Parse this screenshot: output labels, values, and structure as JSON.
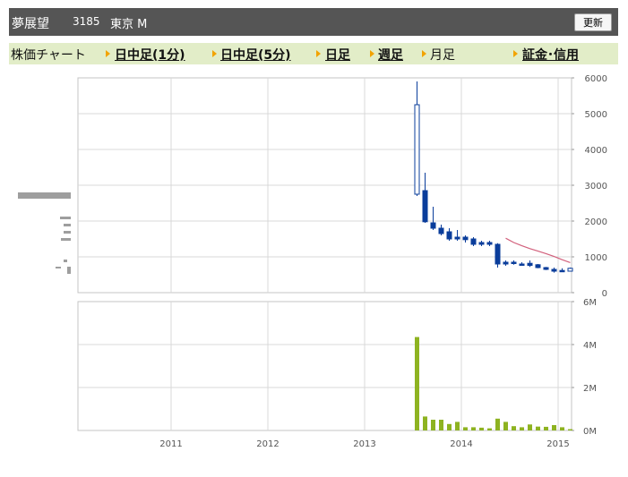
{
  "header": {
    "name": "夢展望",
    "code": "3185",
    "market": "東京 M",
    "refresh_label": "更新"
  },
  "tabs": [
    {
      "label": "株価チャート",
      "link": false
    },
    {
      "label": "日中足(1分)",
      "link": true
    },
    {
      "label": "日中足(5分)",
      "link": true
    },
    {
      "label": "日足",
      "link": true
    },
    {
      "label": "週足",
      "link": true
    },
    {
      "label": "月足",
      "link": false
    },
    {
      "label": "証金･信用",
      "link": true
    }
  ],
  "colors": {
    "candle": "#0a3d9b",
    "moving_average": "#d2607c",
    "volume": "#8eb321",
    "header_bg": "#555555",
    "tab_bg": "#e2edc8",
    "tab_marker": "#f2a300"
  },
  "chart_data": [
    {
      "type": "candlestick",
      "frequency": "monthly",
      "x_ticks": [
        "2011",
        "2012",
        "2013",
        "2014",
        "2015"
      ],
      "y_ticks": [
        "6000",
        "5000",
        "4000",
        "3000",
        "2000",
        "1000",
        "0"
      ],
      "ylim": [
        0,
        6000
      ],
      "grid": true,
      "candles": [
        {
          "date": "2013-07",
          "open": 2750,
          "high": 5900,
          "low": 2700,
          "close": 5250
        },
        {
          "date": "2013-08",
          "open": 2850,
          "high": 3350,
          "low": 1950,
          "close": 1980
        },
        {
          "date": "2013-09",
          "open": 1950,
          "high": 2400,
          "low": 1750,
          "close": 1800
        },
        {
          "date": "2013-10",
          "open": 1800,
          "high": 1900,
          "low": 1600,
          "close": 1650
        },
        {
          "date": "2013-11",
          "open": 1700,
          "high": 1800,
          "low": 1450,
          "close": 1500
        },
        {
          "date": "2013-12",
          "open": 1550,
          "high": 1750,
          "low": 1450,
          "close": 1500
        },
        {
          "date": "2014-01",
          "open": 1550,
          "high": 1600,
          "low": 1400,
          "close": 1480
        },
        {
          "date": "2014-02",
          "open": 1500,
          "high": 1550,
          "low": 1300,
          "close": 1350
        },
        {
          "date": "2014-03",
          "open": 1400,
          "high": 1450,
          "low": 1300,
          "close": 1350
        },
        {
          "date": "2014-04",
          "open": 1400,
          "high": 1450,
          "low": 1300,
          "close": 1350
        },
        {
          "date": "2014-05",
          "open": 1350,
          "high": 1380,
          "low": 700,
          "close": 800
        },
        {
          "date": "2014-06",
          "open": 850,
          "high": 900,
          "low": 750,
          "close": 800
        },
        {
          "date": "2014-07",
          "open": 850,
          "high": 900,
          "low": 780,
          "close": 820
        },
        {
          "date": "2014-08",
          "open": 800,
          "high": 850,
          "low": 760,
          "close": 780
        },
        {
          "date": "2014-09",
          "open": 820,
          "high": 900,
          "low": 720,
          "close": 760
        },
        {
          "date": "2014-10",
          "open": 780,
          "high": 800,
          "low": 680,
          "close": 700
        },
        {
          "date": "2014-11",
          "open": 700,
          "high": 720,
          "low": 630,
          "close": 650
        },
        {
          "date": "2014-12",
          "open": 650,
          "high": 700,
          "low": 560,
          "close": 600
        },
        {
          "date": "2015-01",
          "open": 620,
          "high": 680,
          "low": 580,
          "close": 600
        },
        {
          "date": "2015-02",
          "open": 600,
          "high": 700,
          "low": 590,
          "close": 680
        }
      ],
      "moving_average": [
        {
          "date": "2014-06",
          "value": 1520
        },
        {
          "date": "2014-07",
          "value": 1400
        },
        {
          "date": "2014-08",
          "value": 1310
        },
        {
          "date": "2014-09",
          "value": 1230
        },
        {
          "date": "2014-10",
          "value": 1160
        },
        {
          "date": "2014-11",
          "value": 1090
        },
        {
          "date": "2014-12",
          "value": 1010
        },
        {
          "date": "2015-01",
          "value": 920
        },
        {
          "date": "2015-02",
          "value": 840
        }
      ]
    },
    {
      "type": "bar",
      "frequency": "monthly",
      "x_ticks": [
        "2011",
        "2012",
        "2013",
        "2014",
        "2015"
      ],
      "y_ticks": [
        "6M",
        "4M",
        "2M",
        "0M"
      ],
      "ylim": [
        0,
        6000000
      ],
      "grid": true,
      "categories": [
        "2013-07",
        "2013-08",
        "2013-09",
        "2013-10",
        "2013-11",
        "2013-12",
        "2014-01",
        "2014-02",
        "2014-03",
        "2014-04",
        "2014-05",
        "2014-06",
        "2014-07",
        "2014-08",
        "2014-09",
        "2014-10",
        "2014-11",
        "2014-12",
        "2015-01",
        "2015-02"
      ],
      "values": [
        4350000,
        650000,
        500000,
        500000,
        300000,
        400000,
        150000,
        150000,
        130000,
        100000,
        550000,
        400000,
        200000,
        150000,
        280000,
        180000,
        170000,
        250000,
        150000,
        60000
      ]
    }
  ]
}
